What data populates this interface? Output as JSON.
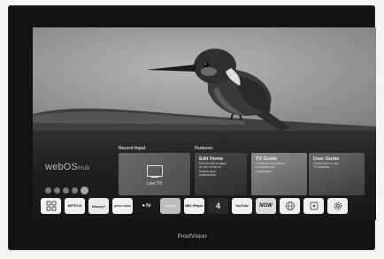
{
  "brand": {
    "name": "webOS",
    "suffix": "Hub"
  },
  "sections": {
    "recent_input": "Recent Input",
    "features": "Features"
  },
  "cards": {
    "live_tv": {
      "label": "Live TV"
    },
    "edit_home": {
      "title": "Edit Home",
      "desc": "Edit the list of apps on the Home to include your preferences."
    },
    "tv_guide": {
      "title": "TV Guide",
      "desc": "Check the broadcast schedule and information."
    },
    "user_guide": {
      "title": "User Guide",
      "desc": "Check how to use TV features."
    }
  },
  "apps": [
    {
      "name": "apps",
      "label": ""
    },
    {
      "name": "netflix",
      "label": "NETFLIX"
    },
    {
      "name": "disney-plus",
      "label": "Disney+"
    },
    {
      "name": "prime-video",
      "label": "prime video"
    },
    {
      "name": "apple-tv",
      "label": "tv"
    },
    {
      "name": "spotify",
      "label": "Spotify"
    },
    {
      "name": "bbc-iplayer",
      "label": "BBC iPlayer"
    },
    {
      "name": "channel-4",
      "label": "4"
    },
    {
      "name": "youtube",
      "label": "YouTube"
    },
    {
      "name": "now",
      "label": "NOW"
    },
    {
      "name": "internet",
      "label": ""
    },
    {
      "name": "help",
      "label": ""
    },
    {
      "name": "settings",
      "label": ""
    }
  ],
  "footer": {
    "brand": "ProofVision"
  },
  "colors": {
    "background": "#f4f4f4",
    "bezel": "#131313",
    "accent": "#e6e6e6"
  }
}
